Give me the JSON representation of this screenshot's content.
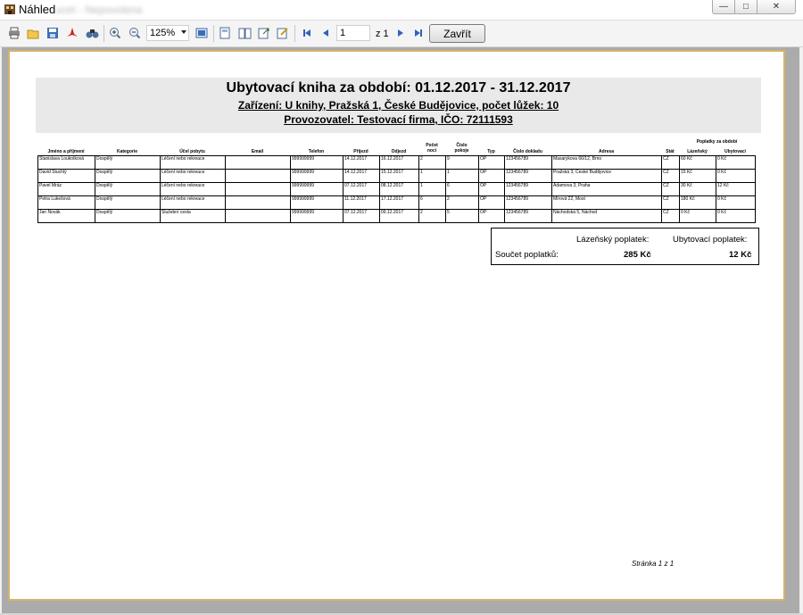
{
  "window": {
    "title": "Náhled",
    "title_blurred": "ucet - Nepovolena",
    "controls": {
      "minimize": "—",
      "maximize": "□",
      "close": "✕"
    }
  },
  "toolbar": {
    "icons": [
      "print-icon",
      "open-icon",
      "save-icon",
      "pdf-icon",
      "find-icon",
      "zoom-in-icon",
      "zoom-out-icon",
      "zoom-fit-icon",
      "single-page-icon",
      "two-page-icon",
      "export-icon",
      "settings-icon",
      "first-page-icon",
      "previous-page-icon",
      "next-page-icon",
      "last-page-icon"
    ],
    "zoom": "125%",
    "page": "1",
    "page_of": "z 1",
    "close_label": "Zavřít"
  },
  "report": {
    "title": "Ubytovací kniha za období: 01.12.2017 - 31.12.2017",
    "facility": "Zařízení: U knihy, Pražská 1, České Budějovice, počet lůžek: 10",
    "operator": "Provozovatel: Testovací firma, IČO: 72111593",
    "fees_group_header": "Poplatky za období",
    "columns": [
      "Jméno a příjmení",
      "Kategorie",
      "Účel pobytu",
      "Email",
      "Telefon",
      "Příjezd",
      "Odjezd",
      "Počet nocí",
      "Číslo pokoje",
      "Typ",
      "Číslo dokladu",
      "Adresa",
      "Stát",
      "Lázeňský",
      "Ubytovací"
    ],
    "rows": [
      [
        "Stanislava Loukotková",
        "Dospělý",
        "Léčení nebo rekreace",
        "",
        "999999999",
        "14.12.2017",
        "16.12.2017",
        "2",
        "9",
        "OP",
        "123456789",
        "Masarykova 66/12, Brno",
        "CZ",
        "60 Kč",
        "0 Kč"
      ],
      [
        "David Stuchlý",
        "Dospělý",
        "Léčení nebo rekreace",
        "",
        "999999999",
        "14.12.2017",
        "15.12.2017",
        "1",
        "1",
        "OP",
        "123456789",
        "Pražská 3, České Budějovice",
        "CZ",
        "15 Kč",
        "0 Kč"
      ],
      [
        "Pavel Mráz",
        "Dospělý",
        "Léčení nebo rekreace",
        "",
        "999999999",
        "07.12.2017",
        "08.12.2017",
        "1",
        "6",
        "OP",
        "123456789",
        "Adamova 3, Praha",
        "CZ",
        "30 Kč",
        "12 Kč"
      ],
      [
        "Petra Lukešová",
        "Dospělý",
        "Léčení nebo rekreace",
        "",
        "999999999",
        "11.12.2017",
        "17.12.2017",
        "6",
        "2",
        "OP",
        "123456789",
        "Mírová 22, Most",
        "CZ",
        "180 Kč",
        "0 Kč"
      ],
      [
        "Jan Novák",
        "Dospělý",
        "Služební cesta",
        "",
        "999999999",
        "07.12.2017",
        "09.12.2017",
        "2",
        "5",
        "OP",
        "123456789",
        "Náchodská 5, Náchod",
        "CZ",
        "0 Kč",
        "0 Kč"
      ]
    ],
    "summary": {
      "spa_fee_label": "Lázeňský poplatek:",
      "lodging_fee_label": "Ubytovací poplatek:",
      "total_label": "Součet poplatků:",
      "spa_fee_total": "285 Kč",
      "lodging_fee_total": "12 Kč"
    },
    "page_number": "Stránka 1 z 1"
  },
  "colors": {
    "page_border": "#d6b468",
    "header_band": "#e9e9e9",
    "preview_bg": "#ababab"
  }
}
